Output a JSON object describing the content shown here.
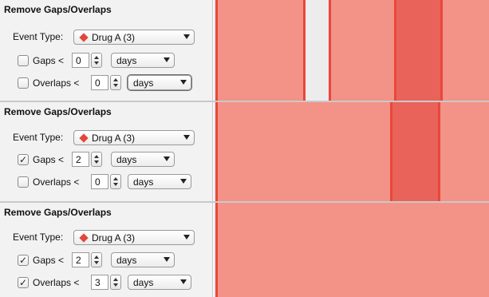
{
  "colors": {
    "bar_fill": "#f39287",
    "bar_edge": "#e9473b",
    "overlap_fill": "#e9635a",
    "event_marker": "#e0483c",
    "timeline_bg": "#ececec",
    "panel_bg": "#f2f2f2"
  },
  "panels": [
    {
      "title": "Remove Gaps/Overlaps",
      "event_type_label": "Event Type:",
      "event_type_value": "Drug A (3)",
      "gaps": {
        "checked": false,
        "check_glyph": "",
        "label": "Gaps <",
        "value": "0",
        "unit": "days"
      },
      "overlaps": {
        "checked": false,
        "check_glyph": "",
        "label": "Overlaps <",
        "value": "0",
        "unit": "days"
      }
    },
    {
      "title": "Remove Gaps/Overlaps",
      "event_type_label": "Event Type:",
      "event_type_value": "Drug A (3)",
      "gaps": {
        "checked": true,
        "check_glyph": "✓",
        "label": "Gaps <",
        "value": "2",
        "unit": "days"
      },
      "overlaps": {
        "checked": false,
        "check_glyph": "",
        "label": "Overlaps <",
        "value": "0",
        "unit": "days"
      }
    },
    {
      "title": "Remove Gaps/Overlaps",
      "event_type_label": "Event Type:",
      "event_type_value": "Drug A (3)",
      "gaps": {
        "checked": true,
        "check_glyph": "✓",
        "label": "Gaps <",
        "value": "2",
        "unit": "days"
      },
      "overlaps": {
        "checked": true,
        "check_glyph": "✓",
        "label": "Overlaps <",
        "value": "3",
        "unit": "days"
      }
    }
  ]
}
